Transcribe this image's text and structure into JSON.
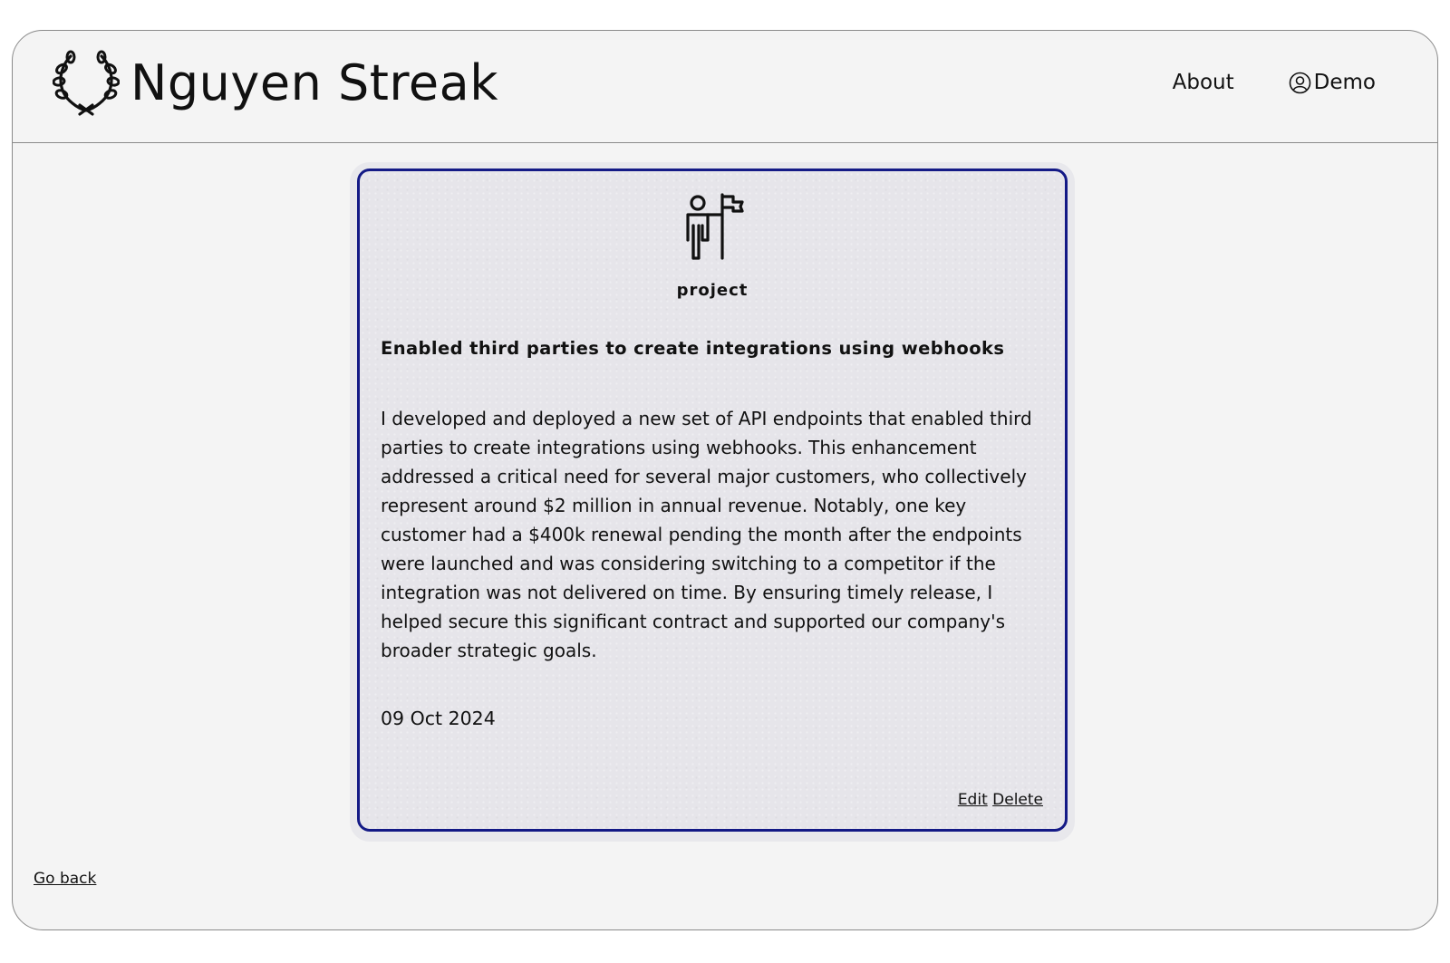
{
  "header": {
    "brand_name": "Nguyen Streak",
    "logo_icon": "laurel-wreath-icon",
    "nav": {
      "about_label": "About",
      "demo_label": "Demo",
      "demo_icon": "user-circle-icon"
    }
  },
  "card": {
    "icon": "person-with-flag-icon",
    "type": "project",
    "title": "Enabled third parties to create integrations using webhooks",
    "body": "I developed and deployed a new set of API endpoints that enabled third parties to create integrations using webhooks. This enhancement addressed a critical need for several major customers, who collectively represent around $2 million in annual revenue. Notably, one key customer had a $400k renewal pending the month after the endpoints were launched and was considering switching to a competitor if the integration was not delivered on time. By ensuring timely release, I helped secure this significant contract and supported our company's broader strategic goals.",
    "date": "09 Oct 2024",
    "edit_label": "Edit",
    "delete_label": "Delete",
    "border_color": "#141a86"
  },
  "footer": {
    "go_back_label": "Go back"
  }
}
